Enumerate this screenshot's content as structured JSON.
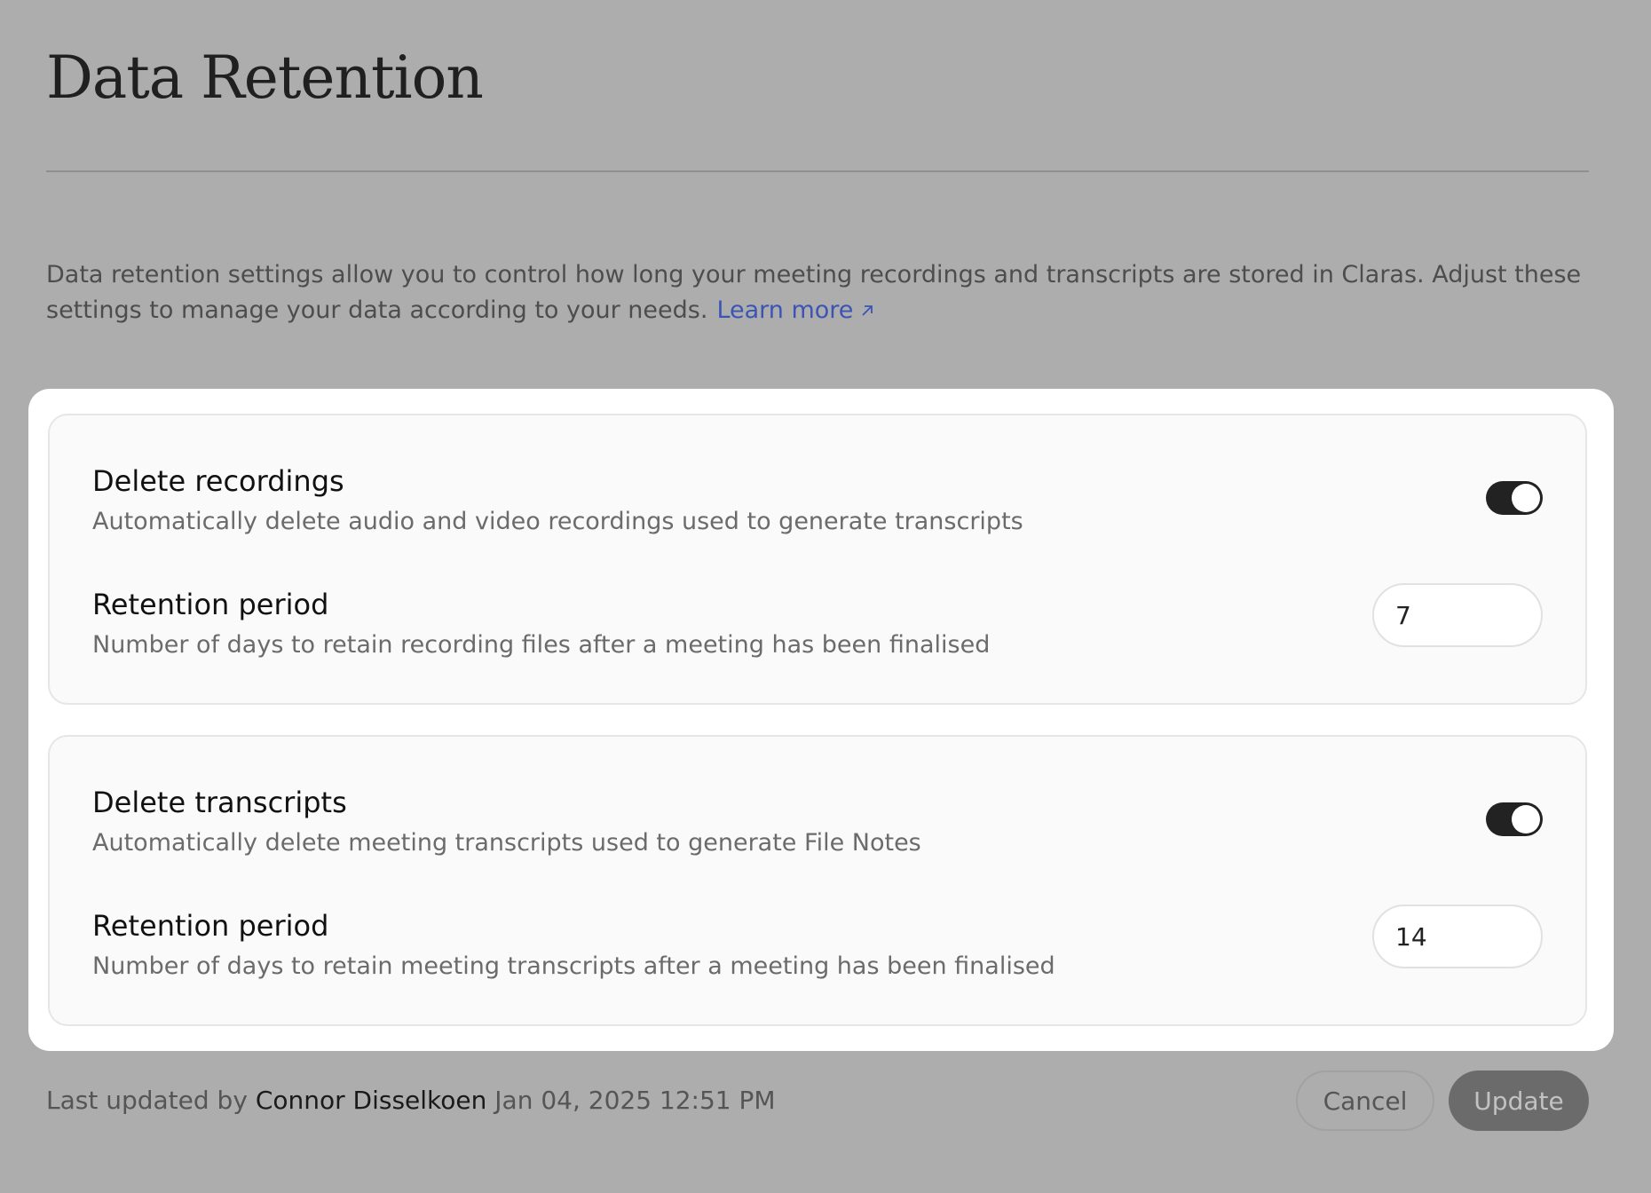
{
  "page": {
    "title": "Data Retention",
    "intro_text": "Data retention settings allow you to control how long your meeting recordings and transcripts are stored in Claras. Adjust these settings to manage your data according to your needs.",
    "learn_more_label": "Learn more",
    "learn_more_icon": "arrow-up-right-icon"
  },
  "colors": {
    "background": "#adadad",
    "link": "#3c55b5",
    "toggle_on": "#222222"
  },
  "recordings": {
    "toggle_label": "Delete recordings",
    "toggle_description": "Automatically delete audio and video recordings used to generate transcripts",
    "toggle_on": true,
    "period_label": "Retention period",
    "period_description": "Number of days to retain recording files after a meeting has been finalised",
    "period_value": "7"
  },
  "transcripts": {
    "toggle_label": "Delete transcripts",
    "toggle_description": "Automatically delete meeting transcripts used to generate File Notes",
    "toggle_on": true,
    "period_label": "Retention period",
    "period_description": "Number of days to retain meeting transcripts after a meeting has been finalised",
    "period_value": "14"
  },
  "footer": {
    "prefix": "Last updated by",
    "user": "Connor Disselkoen",
    "timestamp": "Jan 04, 2025 12:51 PM",
    "cancel_label": "Cancel",
    "update_label": "Update"
  }
}
